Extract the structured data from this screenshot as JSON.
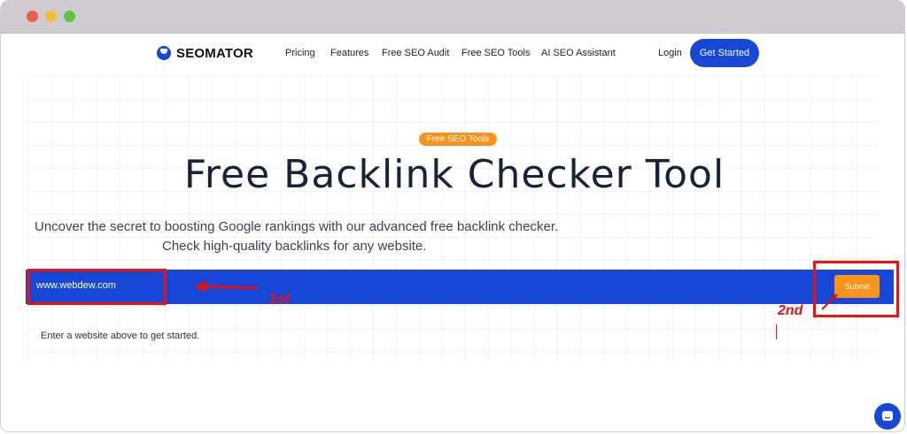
{
  "brand": {
    "name": "SEOMATOR"
  },
  "nav": {
    "items": [
      "Pricing",
      "Features",
      "Free SEO Audit",
      "Free SEO Tools",
      "AI SEO Assistant"
    ],
    "login": "Login",
    "cta": "Get Started"
  },
  "hero": {
    "badge": "Free SEO Tools",
    "title": "Free Backlink Checker Tool",
    "subtitle_line1": "Uncover the secret to boosting Google rankings with our advanced free backlink checker.",
    "subtitle_line2": "Check high-quality backlinks for any website."
  },
  "form": {
    "url_value": "www.webdew.com",
    "submit_label": "Submit",
    "hint": "Enter a website above to get started."
  },
  "annotations": {
    "first": "1st",
    "second": "2nd"
  },
  "colors": {
    "brand_blue": "#1747d6",
    "accent_orange": "#f7931a",
    "annotation_red": "#e11111"
  },
  "icons": {
    "chat": "chat-icon",
    "logo": "seomator-logo-icon"
  }
}
